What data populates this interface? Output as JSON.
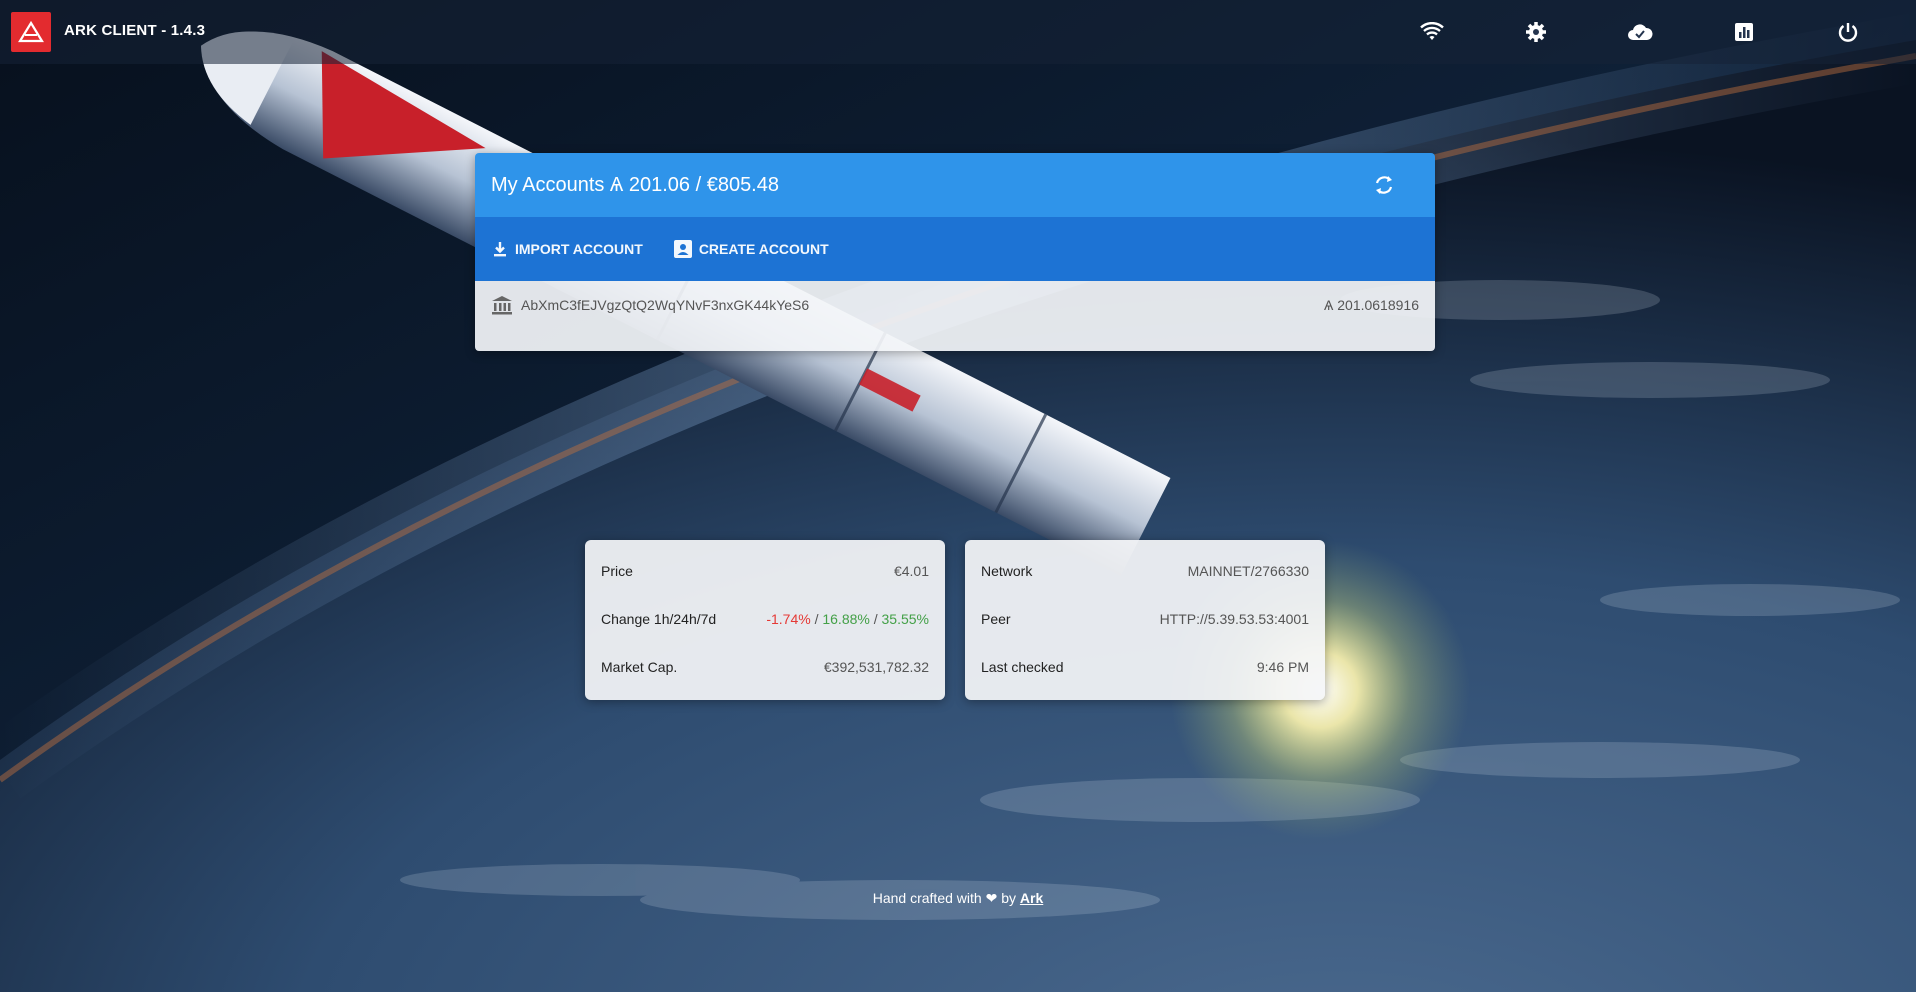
{
  "app": {
    "title": "ARK CLIENT - 1.4.3"
  },
  "topbar": {
    "icons": [
      "wifi-icon",
      "gear-icon",
      "cloud-done-icon",
      "chart-icon",
      "power-icon"
    ]
  },
  "accounts": {
    "title": "My Accounts Ѧ 201.06 / €805.48",
    "import_label": "IMPORT ACCOUNT",
    "create_label": "CREATE ACCOUNT",
    "items": [
      {
        "address": "AbXmC3fEJVgzQtQ2WqYNvF3nxGK44kYeS6",
        "balance": "Ѧ 201.0618916"
      }
    ]
  },
  "market": {
    "price_label": "Price",
    "price_value": "€4.01",
    "change_label": "Change 1h/24h/7d",
    "change_1h": "-1.74%",
    "change_24h": "16.88%",
    "change_7d": "35.55%",
    "separator": "/",
    "marketcap_label": "Market Cap.",
    "marketcap_value": "€392,531,782.32"
  },
  "network": {
    "network_label": "Network",
    "network_value": "MAINNET/2766330",
    "peer_label": "Peer",
    "peer_value": "HTTP://5.39.53.53:4001",
    "checked_label": "Last checked",
    "checked_value": "9:46 PM"
  },
  "footer": {
    "prefix": "Hand crafted with",
    "by": "by",
    "link": "Ark"
  },
  "colors": {
    "brand_red": "#e32b2f",
    "header_blue": "#2f94ea",
    "actions_blue": "#1d73d4",
    "negative": "#e53935",
    "positive": "#43a047"
  }
}
